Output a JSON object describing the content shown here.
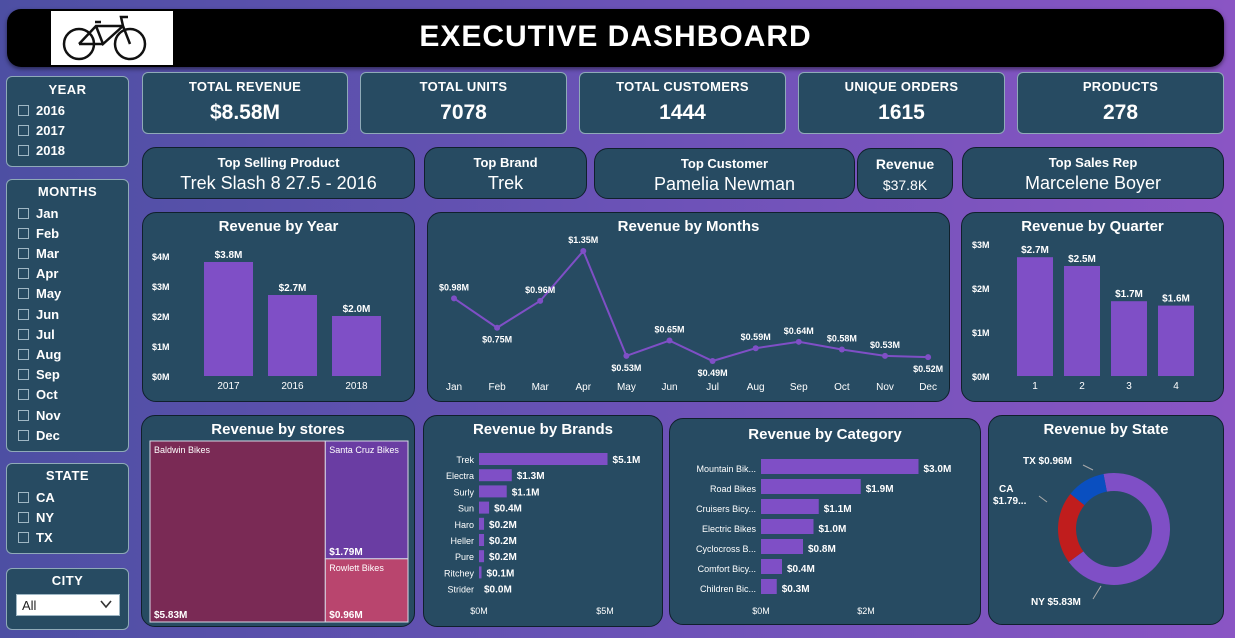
{
  "header": {
    "title": "EXECUTIVE DASHBOARD"
  },
  "filters": {
    "year": {
      "title": "YEAR",
      "options": [
        "2016",
        "2017",
        "2018"
      ]
    },
    "months": {
      "title": "MONTHS",
      "options": [
        "Jan",
        "Feb",
        "Mar",
        "Apr",
        "May",
        "Jun",
        "Jul",
        "Aug",
        "Sep",
        "Oct",
        "Nov",
        "Dec"
      ]
    },
    "state": {
      "title": "STATE",
      "options": [
        "CA",
        "NY",
        "TX"
      ]
    },
    "city": {
      "title": "CITY",
      "selected": "All"
    }
  },
  "kpis": [
    {
      "label": "TOTAL REVENUE",
      "value": "$8.58M"
    },
    {
      "label": "TOTAL UNITS",
      "value": "7078"
    },
    {
      "label": "TOTAL CUSTOMERS",
      "value": "1444"
    },
    {
      "label": "UNIQUE ORDERS",
      "value": "1615"
    },
    {
      "label": "PRODUCTS",
      "value": "278"
    }
  ],
  "highlights": {
    "top_product": {
      "label": "Top Selling Product",
      "value": "Trek Slash 8 27.5 - 2016"
    },
    "top_brand": {
      "label": "Top Brand",
      "value": "Trek"
    },
    "top_customer": {
      "label": "Top Customer",
      "value": "Pamelia Newman"
    },
    "customer_revenue": {
      "label": "Revenue",
      "value": "$37.8K"
    },
    "top_rep": {
      "label": "Top Sales Rep",
      "value": "Marcelene Boyer"
    }
  },
  "colors": {
    "accent": "#7f4fc6",
    "card": "#274b62",
    "store1": "#7a2a55",
    "store2": "#6a3da3",
    "store3": "#b9456e",
    "ny": "#7f4fc6",
    "ca": "#c01d1d",
    "tx": "#0a4fc0"
  },
  "chart_data": [
    {
      "id": "year",
      "type": "bar",
      "title": "Revenue by Year",
      "categories": [
        "2017",
        "2016",
        "2018"
      ],
      "values": [
        3.8,
        2.7,
        2.0
      ],
      "labels": [
        "$3.8M",
        "$2.7M",
        "$2.0M"
      ],
      "yticks": [
        "$0M",
        "$1M",
        "$2M",
        "$3M",
        "$4M"
      ],
      "ylim": [
        0,
        4
      ]
    },
    {
      "id": "months",
      "type": "line",
      "title": "Revenue by Months",
      "categories": [
        "Jan",
        "Feb",
        "Mar",
        "Apr",
        "May",
        "Jun",
        "Jul",
        "Aug",
        "Sep",
        "Oct",
        "Nov",
        "Dec"
      ],
      "values": [
        0.98,
        0.75,
        0.96,
        1.35,
        0.53,
        0.65,
        0.49,
        0.59,
        0.64,
        0.58,
        0.53,
        0.52
      ],
      "labels": [
        "$0.98M",
        "$0.75M",
        "$0.96M",
        "$1.35M",
        "$0.53M",
        "$0.65M",
        "$0.49M",
        "$0.59M",
        "$0.64M",
        "$0.58M",
        "$0.53M",
        "$0.52M"
      ]
    },
    {
      "id": "quarter",
      "type": "bar",
      "title": "Revenue by Quarter",
      "categories": [
        "1",
        "2",
        "3",
        "4"
      ],
      "values": [
        2.7,
        2.5,
        1.7,
        1.6
      ],
      "labels": [
        "$2.7M",
        "$2.5M",
        "$1.7M",
        "$1.6M"
      ],
      "yticks": [
        "$0M",
        "$1M",
        "$2M",
        "$3M"
      ],
      "ylim": [
        0,
        3
      ]
    },
    {
      "id": "stores",
      "type": "treemap",
      "title": "Revenue by stores",
      "items": [
        {
          "name": "Baldwin Bikes",
          "value": 5.83,
          "label": "$5.83M"
        },
        {
          "name": "Santa Cruz Bikes",
          "value": 1.79,
          "label": "$1.79M"
        },
        {
          "name": "Rowlett Bikes",
          "value": 0.96,
          "label": "$0.96M"
        }
      ]
    },
    {
      "id": "brands",
      "type": "bar",
      "orientation": "horizontal",
      "title": "Revenue by Brands",
      "categories": [
        "Trek",
        "Electra",
        "Surly",
        "Sun",
        "Haro",
        "Heller",
        "Pure",
        "Ritchey",
        "Strider"
      ],
      "values": [
        5.1,
        1.3,
        1.1,
        0.4,
        0.2,
        0.2,
        0.2,
        0.1,
        0.0
      ],
      "labels": [
        "$5.1M",
        "$1.3M",
        "$1.1M",
        "$0.4M",
        "$0.2M",
        "$0.2M",
        "$0.2M",
        "$0.1M",
        "$0.0M"
      ],
      "xticks": [
        "$0M",
        "$5M"
      ],
      "xlim": [
        0,
        5
      ]
    },
    {
      "id": "category",
      "type": "bar",
      "orientation": "horizontal",
      "title": "Revenue by Category",
      "categories": [
        "Mountain Bik...",
        "Road Bikes",
        "Cruisers Bicy...",
        "Electric Bikes",
        "Cyclocross B...",
        "Comfort Bicy...",
        "Children Bic..."
      ],
      "values": [
        3.0,
        1.9,
        1.1,
        1.0,
        0.8,
        0.4,
        0.3
      ],
      "labels": [
        "$3.0M",
        "$1.9M",
        "$1.1M",
        "$1.0M",
        "$0.8M",
        "$0.4M",
        "$0.3M"
      ],
      "xticks": [
        "$0M",
        "$2M"
      ],
      "xlim": [
        0,
        2
      ]
    },
    {
      "id": "state",
      "type": "pie",
      "title": "Revenue by State",
      "slices": [
        {
          "name": "NY",
          "value": 5.83,
          "label": "NY $5.83M"
        },
        {
          "name": "CA",
          "value": 1.79,
          "label": "CA $1.79..."
        },
        {
          "name": "TX",
          "value": 0.96,
          "label": "TX $0.96M"
        }
      ]
    }
  ]
}
